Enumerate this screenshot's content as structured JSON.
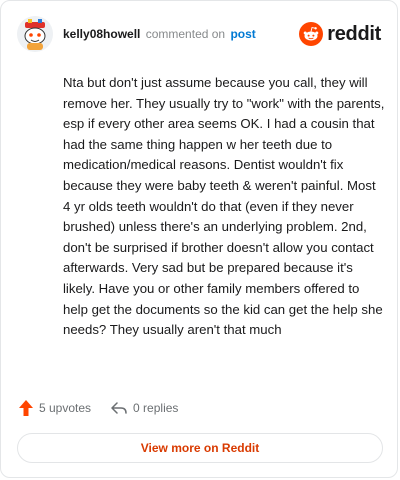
{
  "header": {
    "username": "kelly08howell",
    "action_text": "commented on",
    "post_link": "post",
    "brand_name": "reddit"
  },
  "comment": {
    "text": "Nta but don't just assume because you call, they will remove her. They usually try to \"work\" with the parents, esp if every other area seems OK. I had a cousin that had the same thing happen w her teeth due to medication/medical reasons. Dentist wouldn't fix because they were baby teeth & weren't painful. Most 4 yr olds teeth wouldn't do that (even if they never brushed) unless there's an underlying problem. 2nd, don't be surprised if brother doesn't allow you contact afterwards. Very sad but be prepared because it's likely. Have you or other family members offered to help get the documents so the kid can get the help she needs? They usually aren't that much"
  },
  "actions": {
    "upvotes_label": "5 upvotes",
    "replies_label": "0 replies"
  },
  "footer": {
    "view_more_label": "View more on Reddit"
  },
  "colors": {
    "brand_orange": "#ff4500",
    "link_blue": "#0079d3",
    "view_more": "#d93a00"
  },
  "icons": {
    "avatar": "snoo-avatar",
    "brand": "reddit-logo-icon",
    "upvote": "upvote-arrow-icon",
    "reply": "reply-arrow-icon"
  }
}
